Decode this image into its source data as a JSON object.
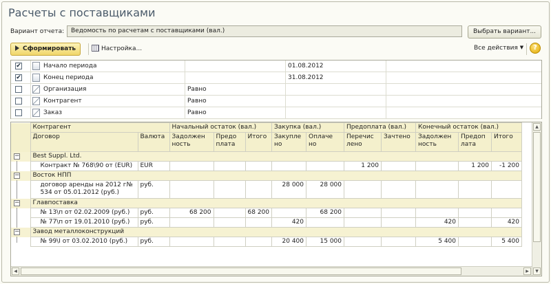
{
  "window": {
    "title": "Расчеты с поставщиками"
  },
  "variant": {
    "label": "Вариант отчета:",
    "value": "Ведомость по расчетам с поставщиками (вал.)",
    "choose_button": "Выбрать вариант..."
  },
  "toolbar": {
    "form_button": "Сформировать",
    "settings_label": "Настройка...",
    "all_actions": "Все действия",
    "help": "?"
  },
  "settings": [
    {
      "checked": true,
      "label": "Начало периода",
      "comparison": "",
      "value": "01.08.2012",
      "icon": "period-icon"
    },
    {
      "checked": true,
      "label": "Конец периода",
      "comparison": "",
      "value": "31.08.2012",
      "icon": "period-icon"
    },
    {
      "checked": false,
      "label": "Организация",
      "comparison": "Равно",
      "value": "",
      "icon": "filter-icon"
    },
    {
      "checked": false,
      "label": "Контрагент",
      "comparison": "Равно",
      "value": "",
      "icon": "filter-icon"
    },
    {
      "checked": false,
      "label": "Заказ",
      "comparison": "Равно",
      "value": "",
      "icon": "filter-icon"
    }
  ],
  "report": {
    "header1": {
      "kontragent": "Контрагент",
      "nach": "Начальный остаток (вал.)",
      "zakupka": "Закупка (вал.)",
      "predoplata": "Предоплата (вал.)",
      "konech": "Конечный остаток (вал.)"
    },
    "header2": {
      "dogovor": "Договор",
      "valuta": "Валюта",
      "c1": "Задолжен ность",
      "c2": "Предо плата",
      "c3": "Итого",
      "c4": "Закупле но",
      "c5": "Оплаче но",
      "c6": "Перечис лено",
      "c7": "Зачтено",
      "c8": "Задолжен ность",
      "c9": "Предоп лата",
      "c10": "Итого"
    },
    "groups": [
      {
        "name": "Best Suppl. Ltd.",
        "rows": [
          {
            "dogovor": "Контракт №  768\\90 от  (EUR)",
            "valuta": "EUR",
            "v": [
              "",
              "",
              "",
              "",
              "",
              "1 200",
              "",
              "",
              "1 200",
              "-1 200"
            ]
          }
        ]
      },
      {
        "name": "Восток НПП",
        "rows": [
          {
            "dogovor": "договор аренды на 2012 г№ 534 от 05.01.2012 (руб.)",
            "valuta": "руб.",
            "v": [
              "",
              "",
              "",
              "28 000",
              "28 000",
              "",
              "",
              "",
              "",
              ""
            ]
          }
        ]
      },
      {
        "name": "Главпоставка",
        "rows": [
          {
            "dogovor": "№ 13\\п от 02.02.2009 (руб.)",
            "valuta": "руб.",
            "v": [
              "68 200",
              "",
              "68 200",
              "",
              "68 200",
              "",
              "",
              "",
              "",
              ""
            ]
          },
          {
            "dogovor": "№ 77\\п от 19.01.2010 (руб.)",
            "valuta": "руб.",
            "v": [
              "",
              "",
              "",
              "420",
              "",
              "",
              "",
              "420",
              "",
              "420"
            ]
          }
        ]
      },
      {
        "name": "Завод металлоконструкций",
        "rows": [
          {
            "dogovor": "№ 99\\I от 03.02.2010 (руб.)",
            "valuta": "руб.",
            "v": [
              "",
              "",
              "",
              "20 400",
              "15 000",
              "",
              "",
              "5 400",
              "",
              "5 400"
            ]
          }
        ]
      }
    ]
  }
}
